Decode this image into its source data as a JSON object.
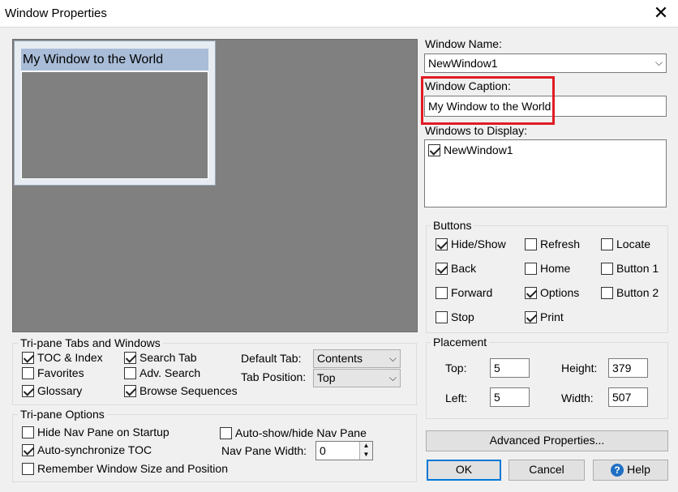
{
  "window": {
    "title": "Window Properties",
    "close_glyph": "✕"
  },
  "preview": {
    "caption": "My Window to the World"
  },
  "right": {
    "window_name_label": "Window Name:",
    "window_name_value": "NewWindow1",
    "window_caption_label": "Window Caption:",
    "window_caption_value": "My Window to the World",
    "windows_to_display_label": "Windows to Display:",
    "windows_to_display": [
      {
        "label": "NewWindow1",
        "checked": true
      }
    ]
  },
  "buttons_group": {
    "title": "Buttons",
    "items": [
      {
        "label": "Hide/Show",
        "checked": true
      },
      {
        "label": "Refresh",
        "checked": false
      },
      {
        "label": "Locate",
        "checked": false
      },
      {
        "label": "Back",
        "checked": true
      },
      {
        "label": "Home",
        "checked": false
      },
      {
        "label": "Button 1",
        "checked": false
      },
      {
        "label": "Forward",
        "checked": false
      },
      {
        "label": "Options",
        "checked": true
      },
      {
        "label": "Button 2",
        "checked": false
      },
      {
        "label": "Stop",
        "checked": false
      },
      {
        "label": "Print",
        "checked": true
      }
    ]
  },
  "placement": {
    "title": "Placement",
    "top_label": "Top:",
    "top_value": "5",
    "left_label": "Left:",
    "left_value": "5",
    "height_label": "Height:",
    "height_value": "379",
    "width_label": "Width:",
    "width_value": "507"
  },
  "tripane_tabs": {
    "title": "Tri-pane Tabs and Windows",
    "toc_index": {
      "label": "TOC & Index",
      "checked": true
    },
    "search_tab": {
      "label": "Search Tab",
      "checked": true
    },
    "favorites": {
      "label": "Favorites",
      "checked": false
    },
    "adv_search": {
      "label": "Adv. Search",
      "checked": false
    },
    "glossary": {
      "label": "Glossary",
      "checked": true
    },
    "browse_sequences": {
      "label": "Browse Sequences",
      "checked": true
    },
    "default_tab_label": "Default Tab:",
    "default_tab_value": "Contents",
    "tab_position_label": "Tab Position:",
    "tab_position_value": "Top"
  },
  "tripane_options": {
    "title": "Tri-pane Options",
    "hide_nav": {
      "label": "Hide Nav Pane on Startup",
      "checked": false
    },
    "auto_sync": {
      "label": "Auto-synchronize TOC",
      "checked": true
    },
    "remember": {
      "label": "Remember Window Size and Position",
      "checked": false
    },
    "auto_show": {
      "label": "Auto-show/hide Nav Pane",
      "checked": false
    },
    "nav_width_label": "Nav Pane Width:",
    "nav_width_value": "0"
  },
  "actions": {
    "advanced": "Advanced Properties...",
    "ok": "OK",
    "cancel": "Cancel",
    "help": "Help",
    "help_glyph": "?"
  }
}
